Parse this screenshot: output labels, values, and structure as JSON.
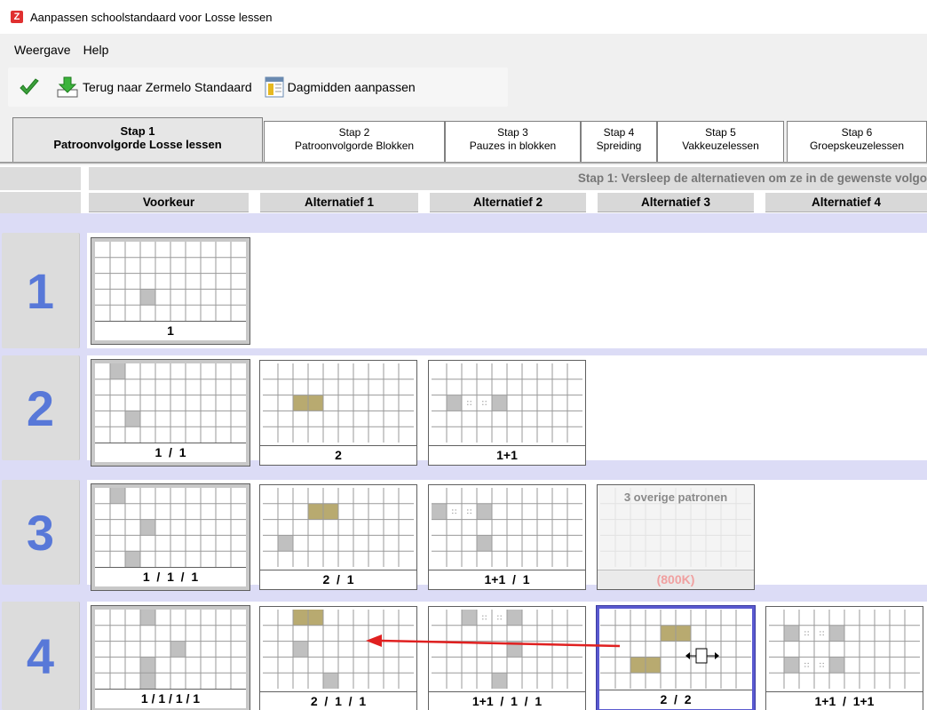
{
  "window": {
    "title": "Aanpassen schoolstandaard voor Losse lessen",
    "app_icon": "Z"
  },
  "menu": {
    "items": [
      "Weergave",
      "Help"
    ]
  },
  "toolbar": {
    "terug_label": "Terug naar Zermelo Standaard",
    "dagmidden_label": "Dagmidden aanpassen"
  },
  "tabs": [
    {
      "line1": "Stap 1",
      "line2": "Patroonvolgorde Losse lessen",
      "active": true
    },
    {
      "line1": "Stap 2",
      "line2": "Patroonvolgorde Blokken"
    },
    {
      "line1": "Stap 3",
      "line2": "Pauzes in blokken"
    },
    {
      "line1": "Stap 4",
      "line2": "Spreiding"
    },
    {
      "line1": "Stap 5",
      "line2": "Vakkeuzelessen"
    },
    {
      "line1": "Stap 6",
      "line2": "Groepskeuzelessen"
    }
  ],
  "instruction": "Stap 1: Versleep de alternatieven om ze in de gewenste volgo",
  "columns": [
    "Voorkeur",
    "Alternatief 1",
    "Alternatief 2",
    "Alternatief 3",
    "Alternatief 4"
  ],
  "rows": [
    {
      "number": "1",
      "cards": [
        {
          "label": "1",
          "cells": [
            [
              3,
              3,
              "grey"
            ]
          ]
        }
      ]
    },
    {
      "number": "2",
      "cards": [
        {
          "label": "1  /  1",
          "cells": [
            [
              0,
              1,
              "grey"
            ],
            [
              3,
              2,
              "grey"
            ]
          ]
        },
        {
          "label": "2",
          "cells": [
            [
              2,
              2,
              "gold"
            ],
            [
              2,
              3,
              "gold"
            ]
          ]
        },
        {
          "label": "1+1",
          "cells": [
            [
              2,
              1,
              "grey"
            ],
            [
              2,
              2,
              "dot"
            ],
            [
              2,
              3,
              "dot"
            ],
            [
              2,
              4,
              "grey"
            ]
          ]
        }
      ]
    },
    {
      "number": "3",
      "cards": [
        {
          "label": "1  /  1  /  1",
          "cells": [
            [
              0,
              1,
              "grey"
            ],
            [
              2,
              3,
              "grey"
            ],
            [
              4,
              2,
              "grey"
            ]
          ]
        },
        {
          "label": "2  /  1",
          "cells": [
            [
              1,
              3,
              "gold"
            ],
            [
              1,
              4,
              "gold"
            ],
            [
              3,
              1,
              "grey"
            ]
          ]
        },
        {
          "label": "1+1  /  1",
          "cells": [
            [
              1,
              0,
              "grey"
            ],
            [
              1,
              1,
              "dot"
            ],
            [
              1,
              2,
              "dot"
            ],
            [
              1,
              3,
              "grey"
            ],
            [
              3,
              3,
              "grey"
            ]
          ]
        },
        {
          "other": true,
          "text": "3 overige patronen",
          "label": "(800K)"
        }
      ]
    },
    {
      "number": "4",
      "cards": [
        {
          "label": "1 / 1 / 1 / 1",
          "cells": [
            [
              0,
              3,
              "grey"
            ],
            [
              2,
              5,
              "grey"
            ],
            [
              3,
              3,
              "grey"
            ],
            [
              4,
              3,
              "grey"
            ]
          ]
        },
        {
          "label": "2  /  1  /  1",
          "cells": [
            [
              0,
              2,
              "gold"
            ],
            [
              0,
              3,
              "gold"
            ],
            [
              2,
              2,
              "grey"
            ],
            [
              4,
              4,
              "grey"
            ]
          ]
        },
        {
          "label": "1+1  /  1  /  1",
          "cells": [
            [
              0,
              2,
              "grey"
            ],
            [
              0,
              3,
              "dot"
            ],
            [
              0,
              4,
              "dot"
            ],
            [
              0,
              5,
              "grey"
            ],
            [
              2,
              5,
              "grey"
            ],
            [
              4,
              4,
              "grey"
            ]
          ]
        },
        {
          "label": "2  /  2",
          "selected": true,
          "cells": [
            [
              1,
              4,
              "gold"
            ],
            [
              1,
              5,
              "gold"
            ],
            [
              3,
              2,
              "gold"
            ],
            [
              3,
              3,
              "gold"
            ]
          ]
        },
        {
          "label": "1+1  /  1+1",
          "cells": [
            [
              1,
              1,
              "grey"
            ],
            [
              1,
              2,
              "dot"
            ],
            [
              1,
              3,
              "dot"
            ],
            [
              1,
              4,
              "grey"
            ],
            [
              3,
              1,
              "grey"
            ],
            [
              3,
              2,
              "dot"
            ],
            [
              3,
              3,
              "dot"
            ],
            [
              3,
              4,
              "grey"
            ]
          ]
        }
      ]
    }
  ],
  "colors": {
    "grey_cell": "#c0c0c0",
    "gold_cell": "#b8aa70",
    "row_band": "#dcdcf6",
    "row_number": "#5878d8",
    "drag_arrow": "#e02020"
  }
}
